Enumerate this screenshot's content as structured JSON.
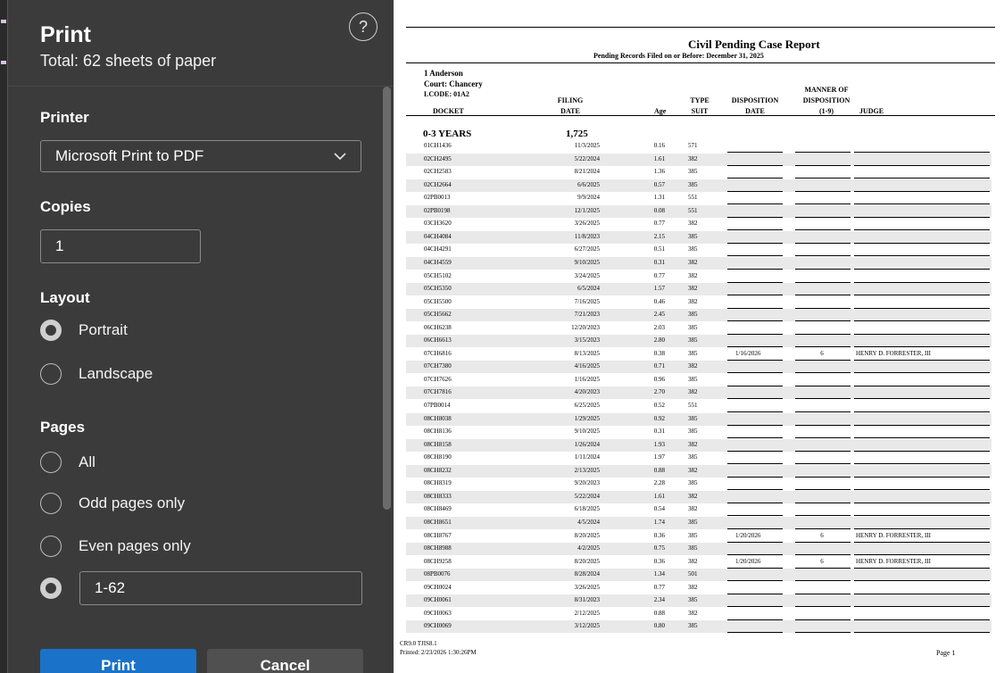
{
  "panel": {
    "title": "Print",
    "subtitle": "Total: 62 sheets of paper",
    "help_label": "?",
    "printer_heading": "Printer",
    "printer_value": "Microsoft Print to PDF",
    "copies_heading": "Copies",
    "copies_value": "1",
    "layout_heading": "Layout",
    "layout_options": [
      "Portrait",
      "Landscape"
    ],
    "layout_selected": "Portrait",
    "pages_heading": "Pages",
    "pages_options": [
      "All",
      "Odd pages only",
      "Even pages only"
    ],
    "pages_custom_value": "1-62",
    "pages_selected": "custom",
    "print_button": "Print",
    "cancel_button": "Cancel",
    "accent_color": "#1a73c8"
  },
  "report": {
    "title": "Civil Pending Case Report",
    "subtitle": "Pending Records Filed on or Before: December 31, 2025",
    "county_line": "1   Anderson",
    "court_line": "Court:  Chancery",
    "lcode_line": "LCODE:  01A2",
    "headers": {
      "docket": "DOCKET",
      "filing1": "FILING",
      "filing2": "DATE",
      "age": "Age",
      "type1": "TYPE",
      "type2": "SUIT",
      "disp1": "DISPOSITION",
      "disp2": "DATE",
      "manner1": "MANNER OF",
      "manner2": "DISPOSITION",
      "manner3": "(1-9)",
      "judge": "JUDGE"
    },
    "group_label": "0-3 YEARS",
    "group_count": "1,725",
    "rows": [
      [
        "01CH1436",
        "11/3/2025",
        "0.16",
        "571",
        "",
        "",
        ""
      ],
      [
        "02CH2495",
        "5/22/2024",
        "1.61",
        "382",
        "",
        "",
        ""
      ],
      [
        "02CH2583",
        "8/21/2024",
        "1.36",
        "385",
        "",
        "",
        ""
      ],
      [
        "02CH2664",
        "6/6/2025",
        "0.57",
        "385",
        "",
        "",
        ""
      ],
      [
        "02PB0013",
        "9/9/2024",
        "1.31",
        "551",
        "",
        "",
        ""
      ],
      [
        "02PB0198",
        "12/1/2025",
        "0.08",
        "551",
        "",
        "",
        ""
      ],
      [
        "03CH3620",
        "3/26/2025",
        "0.77",
        "382",
        "",
        "",
        ""
      ],
      [
        "04CH4084",
        "11/8/2023",
        "2.15",
        "385",
        "",
        "",
        ""
      ],
      [
        "04CH4291",
        "6/27/2025",
        "0.51",
        "385",
        "",
        "",
        ""
      ],
      [
        "04CH4559",
        "9/10/2025",
        "0.31",
        "382",
        "",
        "",
        ""
      ],
      [
        "05CH5102",
        "3/24/2025",
        "0.77",
        "382",
        "",
        "",
        ""
      ],
      [
        "05CH5350",
        "6/5/2024",
        "1.57",
        "382",
        "",
        "",
        ""
      ],
      [
        "05CH5500",
        "7/16/2025",
        "0.46",
        "382",
        "",
        "",
        ""
      ],
      [
        "05CH5662",
        "7/21/2023",
        "2.45",
        "385",
        "",
        "",
        ""
      ],
      [
        "06CH6238",
        "12/20/2023",
        "2.03",
        "385",
        "",
        "",
        ""
      ],
      [
        "06CH6613",
        "3/15/2023",
        "2.80",
        "385",
        "",
        "",
        ""
      ],
      [
        "07CH6816",
        "8/13/2025",
        "0.38",
        "385",
        "1/16/2026",
        "6",
        "HENRY D. FORRESTER, III"
      ],
      [
        "07CH7380",
        "4/16/2025",
        "0.71",
        "382",
        "",
        "",
        ""
      ],
      [
        "07CH7626",
        "1/16/2025",
        "0.96",
        "385",
        "",
        "",
        ""
      ],
      [
        "07CH7816",
        "4/20/2023",
        "2.70",
        "382",
        "",
        "",
        ""
      ],
      [
        "07PB0014",
        "6/25/2025",
        "0.52",
        "551",
        "",
        "",
        ""
      ],
      [
        "08CH8038",
        "1/29/2025",
        "0.92",
        "385",
        "",
        "",
        ""
      ],
      [
        "08CH8136",
        "9/10/2025",
        "0.31",
        "385",
        "",
        "",
        ""
      ],
      [
        "08CH8158",
        "1/26/2024",
        "1.93",
        "382",
        "",
        "",
        ""
      ],
      [
        "08CH8190",
        "1/11/2024",
        "1.97",
        "385",
        "",
        "",
        ""
      ],
      [
        "08CH8232",
        "2/13/2025",
        "0.88",
        "382",
        "",
        "",
        ""
      ],
      [
        "08CH8319",
        "9/20/2023",
        "2.28",
        "385",
        "",
        "",
        ""
      ],
      [
        "08CH8333",
        "5/22/2024",
        "1.61",
        "382",
        "",
        "",
        ""
      ],
      [
        "08CH8469",
        "6/18/2025",
        "0.54",
        "382",
        "",
        "",
        ""
      ],
      [
        "08CH8651",
        "4/5/2024",
        "1.74",
        "385",
        "",
        "",
        ""
      ],
      [
        "08CH8767",
        "8/20/2025",
        "0.36",
        "385",
        "1/20/2026",
        "6",
        "HENRY D. FORRESTER, III"
      ],
      [
        "08CH8988",
        "4/2/2025",
        "0.75",
        "385",
        "",
        "",
        ""
      ],
      [
        "08CH9258",
        "8/20/2025",
        "0.36",
        "382",
        "1/20/2026",
        "6",
        "HENRY D. FORRESTER, III"
      ],
      [
        "08PB0076",
        "8/28/2024",
        "1.34",
        "501",
        "",
        "",
        ""
      ],
      [
        "09CH0024",
        "3/26/2025",
        "0.77",
        "382",
        "",
        "",
        ""
      ],
      [
        "09CH0061",
        "8/31/2023",
        "2.34",
        "385",
        "",
        "",
        ""
      ],
      [
        "09CH0063",
        "2/12/2025",
        "0.88",
        "382",
        "",
        "",
        ""
      ],
      [
        "09CH0069",
        "3/12/2025",
        "0.80",
        "385",
        "",
        "",
        ""
      ]
    ],
    "footer_version": "CR9.0 TJIS8.1",
    "footer_printed": "Printed: 2/23/2026  1:30:26PM",
    "footer_page": "Page    1"
  }
}
